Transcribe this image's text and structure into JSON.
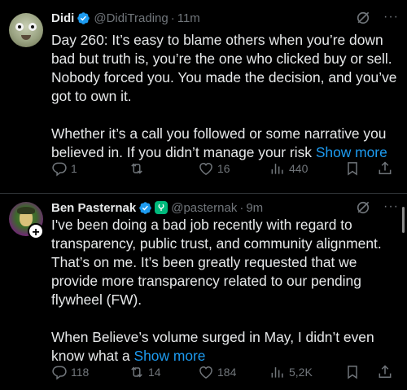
{
  "tweets": [
    {
      "author": {
        "name": "Didi",
        "handle": "@DidiTrading",
        "time": "11m"
      },
      "text": {
        "p1": "Day 260: It’s easy to blame others when you’re down bad but truth is, you’re the one who clicked buy or sell. Nobody forced you. You made the decision, and you’ve got to own it.",
        "p2": "Whether it’s a call you followed or some narrative you believed in. If you didn’t manage your risk ",
        "show_more": "Show more"
      },
      "stats": {
        "replies": "1",
        "reposts": "",
        "likes": "16",
        "views": "440"
      }
    },
    {
      "author": {
        "name": "Ben Pasternak",
        "handle": "@pasternak",
        "time": "9m"
      },
      "text": {
        "p1": "I've been doing a bad job recently with regard to transparency, public trust, and community alignment. That’s on me. It’s been greatly requested that we provide more transparency related to our pending flywheel (FW).",
        "p2": "When Believe’s volume surged in May, I didn’t even know what a ",
        "show_more": "Show more"
      },
      "stats": {
        "replies": "118",
        "reposts": "14",
        "likes": "184",
        "views": "5,2K"
      }
    }
  ],
  "follow_badge": "+",
  "more_glyph": "···",
  "dot": "·",
  "colors": {
    "accent": "#1d9bf0",
    "muted": "#71767b",
    "verified": "#1d9bf0",
    "affiliate": "#00ba7c"
  },
  "icons": [
    "verified-icon",
    "grok-icon",
    "more-icon",
    "reply-icon",
    "repost-icon",
    "like-icon",
    "views-icon",
    "bookmark-icon",
    "share-icon"
  ]
}
